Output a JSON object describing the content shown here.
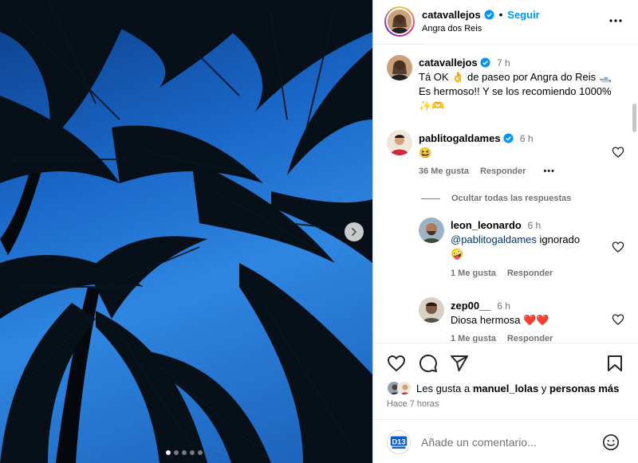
{
  "post": {
    "author": "catavallejos",
    "follow_label": "Seguir",
    "separator": "•",
    "location": "Angra dos Reis",
    "carousel_dots": 5,
    "carousel_active": 0
  },
  "caption": {
    "author": "catavallejos",
    "time": "7 h",
    "text": "Tá OK 👌 de paseo por Angra do Reis 🛥️ Es hermoso!! Y se los recomiendo 1000% ✨🫶"
  },
  "comments": [
    {
      "author": "pablitogaldames",
      "verified": true,
      "time": "6 h",
      "text": "😆",
      "likes": "36 Me gusta",
      "reply_label": "Responder",
      "more": "•••"
    }
  ],
  "replies_toggle": "Ocultar todas las respuestas",
  "replies": [
    {
      "author": "leon_leonardo",
      "time": "6 h",
      "mention": "@pablitogaldames",
      "text": " ignorado",
      "emoji": "🤪",
      "likes": "1 Me gusta",
      "reply_label": "Responder"
    },
    {
      "author": "zep00__",
      "time": "6 h",
      "text": "Diosa hermosa ❤️❤️",
      "likes": "1 Me gusta",
      "reply_label": "Responder"
    }
  ],
  "likes": {
    "prefix": "Les gusta a ",
    "user": "manuel_lolas",
    "joiner": " y ",
    "others": "personas más"
  },
  "posted_ago": "Hace 7 horas",
  "comment_input": {
    "placeholder": "Añade un comentario..."
  },
  "icons": {
    "heart": "heart-icon",
    "comment": "comment-icon",
    "share": "share-icon",
    "save": "bookmark-icon",
    "emoji": "emoji-icon",
    "more": "more-icon",
    "next": "chevron-right-icon"
  },
  "colors": {
    "accent": "#0095f6",
    "secondary_text": "#737373",
    "verified": "#0095f6"
  }
}
